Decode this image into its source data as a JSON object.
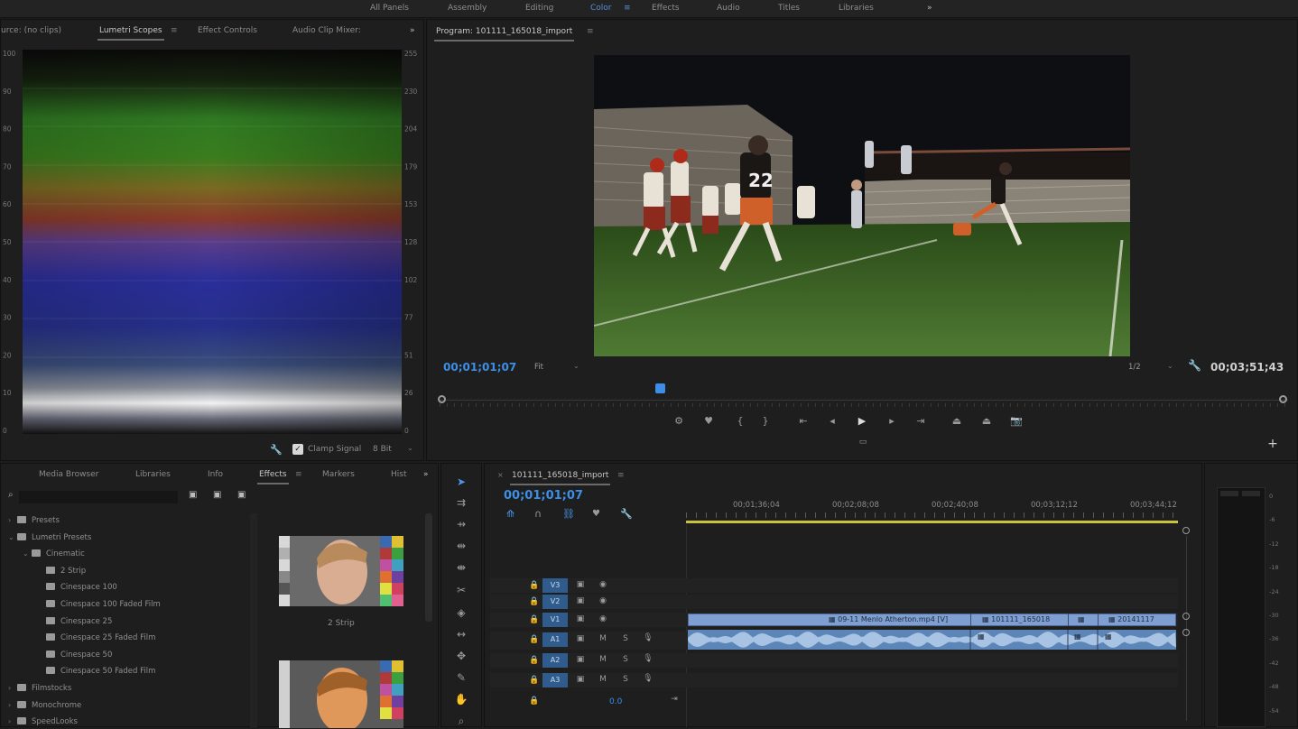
{
  "workspaces": {
    "items": [
      "All Panels",
      "Assembly",
      "Editing",
      "Color",
      "Effects",
      "Audio",
      "Titles",
      "Libraries"
    ],
    "active": "Color",
    "overflow": "»"
  },
  "source_panel": {
    "tabs": [
      "urce: (no clips)",
      "Lumetri Scopes",
      "Effect Controls",
      "Audio Clip Mixer:"
    ],
    "active_tab": "Lumetri Scopes",
    "overflow": "»",
    "scope_left_ticks": [
      "100",
      "90",
      "80",
      "70",
      "60",
      "50",
      "40",
      "30",
      "20",
      "10",
      "0"
    ],
    "scope_right_ticks": [
      "255",
      "230",
      "204",
      "179",
      "153",
      "128",
      "102",
      "77",
      "51",
      "26",
      "0"
    ],
    "clamp_label": "Clamp Signal",
    "bit_depth": "8 Bit"
  },
  "program_monitor": {
    "title": "Program: 101111_165018_import",
    "timecode_current": "00;01;01;07",
    "zoom": "Fit",
    "resolution": "1/2",
    "timecode_total": "00;03;51;43",
    "playhead_fraction": 0.26
  },
  "project_panel": {
    "tabs": [
      "Media Browser",
      "Libraries",
      "Info",
      "Effects",
      "Markers",
      "Hist"
    ],
    "active_tab": "Effects",
    "search_value": "",
    "tree": [
      {
        "label": "Presets",
        "level": 0,
        "caret": "›"
      },
      {
        "label": "Lumetri Presets",
        "level": 0,
        "caret": "⌄"
      },
      {
        "label": "Cinematic",
        "level": 1,
        "caret": "⌄"
      },
      {
        "label": "2 Strip",
        "level": 2,
        "caret": ""
      },
      {
        "label": "Cinespace 100",
        "level": 2,
        "caret": ""
      },
      {
        "label": "Cinespace 100 Faded Film",
        "level": 2,
        "caret": ""
      },
      {
        "label": "Cinespace 25",
        "level": 2,
        "caret": ""
      },
      {
        "label": "Cinespace 25 Faded Film",
        "level": 2,
        "caret": ""
      },
      {
        "label": "Cinespace 50",
        "level": 2,
        "caret": ""
      },
      {
        "label": "Cinespace 50 Faded Film",
        "level": 2,
        "caret": ""
      },
      {
        "label": "Filmstocks",
        "level": 0,
        "caret": "›"
      },
      {
        "label": "Monochrome",
        "level": 0,
        "caret": "›"
      },
      {
        "label": "SpeedLooks",
        "level": 0,
        "caret": "›"
      }
    ],
    "preview_caption": "2 Strip"
  },
  "timeline": {
    "sequence_name": "101111_165018_import",
    "timecode": "00;01;01;07",
    "ruler": [
      "00;01;36;04",
      "00;02;08;08",
      "00;02;40;08",
      "00;03;12;12",
      "00;03;44;12"
    ],
    "video_tracks": [
      "V3",
      "V2",
      "V1"
    ],
    "audio_tracks": [
      "A1",
      "A2",
      "A3"
    ],
    "track_m": "M",
    "track_s": "S",
    "master_value": "0.0",
    "clips": [
      "09-11 Menlo Atherton.mp4 [V]",
      "101111_165018",
      "20141117"
    ]
  },
  "audio_meter": {
    "labels": [
      "0",
      "-6",
      "-12",
      "-18",
      "-24",
      "-30",
      "-36",
      "-42",
      "-48",
      "-54"
    ]
  },
  "colors": {
    "accent": "#3d8ee6",
    "track_label": "#2f5c8c",
    "video_clip": "#7f9fd2",
    "audio_clip": "#5d86b8",
    "work_area": "#c8c23e"
  }
}
